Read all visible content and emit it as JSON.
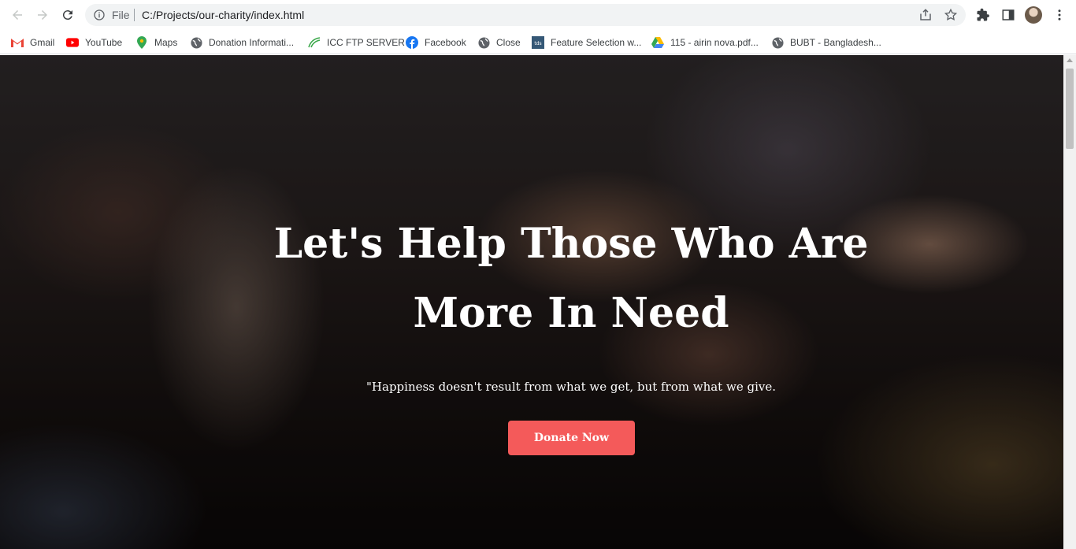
{
  "browser": {
    "address": {
      "scheme_label": "File",
      "url": "C:/Projects/our-charity/index.html"
    },
    "icons": {
      "back": "back-arrow-icon",
      "forward": "forward-arrow-icon",
      "reload": "reload-icon",
      "info": "info-icon",
      "share": "share-icon",
      "bookmark": "star-icon",
      "extensions": "puzzle-icon",
      "side_panel": "side-panel-icon",
      "menu": "kebab-menu-icon"
    },
    "bookmarks": [
      {
        "label": "Gmail",
        "icon": "gmail-icon"
      },
      {
        "label": "YouTube",
        "icon": "youtube-icon"
      },
      {
        "label": "Maps",
        "icon": "maps-icon"
      },
      {
        "label": "Donation Informati...",
        "icon": "globe-icon"
      },
      {
        "label": "ICC FTP SERVER",
        "icon": "icc-icon"
      },
      {
        "label": "Facebook",
        "icon": "facebook-icon"
      },
      {
        "label": "Close",
        "icon": "globe-icon"
      },
      {
        "label": "Feature Selection w...",
        "icon": "tds-icon"
      },
      {
        "label": "115 - airin nova.pdf...",
        "icon": "drive-icon"
      },
      {
        "label": "BUBT - Bangladesh...",
        "icon": "globe-icon"
      }
    ]
  },
  "hero": {
    "title_line1": "Let's Help Those Who Are",
    "title_line2": "More In Need",
    "quote": "\"Happiness doesn't result from what we get, but from what we give.",
    "donate_label": "Donate Now"
  },
  "colors": {
    "accent": "#f45a5a",
    "hero_text": "#ffffff"
  }
}
